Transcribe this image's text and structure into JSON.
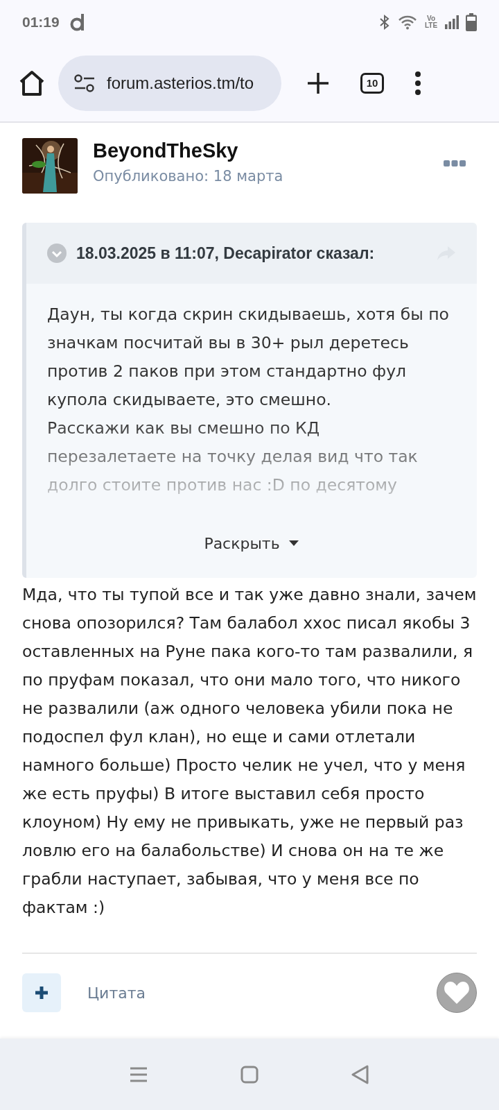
{
  "status_bar": {
    "time": "01:19",
    "network_label": "Vo LTE"
  },
  "browser": {
    "url": "forum.asterios.tm/to",
    "tab_count": "10"
  },
  "post": {
    "author": "BeyondTheSky",
    "published": "Опубликовано: 18 марта",
    "quote": {
      "expanded": false,
      "header": "18.03.2025 в 11:07, Decapirator сказал:",
      "paragraphs": [
        "Даун, ты когда скрин скидываешь, хотя бы по значкам посчитай вы в 30+ рыл деретесь против 2 паков при этом стандартно фул купола скидываете, это смешно.",
        "Расскажи как вы смешно по КД перезалетаете на точку делая вид что так долго стоите против нас :D по десятому"
      ],
      "toggle": "Раскрыть"
    },
    "text": "Мда, что ты тупой все и так уже давно знали, зачем снова опозорился? Там балабол ххос писал якобы 3 оставленных на Руне пака кого-то там развалили, я по пруфам показал, что они мало того, что никого не развалили (аж одного человека убили пока не подоспел фул клан), но еще и сами отлетали намного больше) Просто челик не учел, что у меня же есть пруфы) В итоге выставил себя просто клоуном) Ну ему не привыкать, уже не первый раз ловлю его на балабольстве) И снова он на те же грабли наступает, забывая, что у меня все по фактам :)",
    "quote_button": "Цитата",
    "liked": false
  }
}
